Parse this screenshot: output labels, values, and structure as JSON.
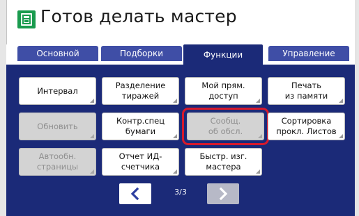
{
  "header": {
    "title": "Готов делать мастер",
    "icon": "master-making-icon",
    "icon_color": "#1a9b4e"
  },
  "tabs": [
    {
      "label": "Основной",
      "active": false
    },
    {
      "label": "Подборки",
      "active": false
    },
    {
      "label": "Функции",
      "active": true
    },
    {
      "label": "Управление",
      "active": false
    }
  ],
  "functions": {
    "interval": {
      "label": "Интервал",
      "enabled": true
    },
    "job_separation": {
      "label": "Разделение\nтиражей",
      "enabled": true
    },
    "my_direct_access": {
      "label": "Мой прям.\nдоступ",
      "enabled": true
    },
    "print_from_memory": {
      "label": "Печать\nиз памяти",
      "enabled": true
    },
    "refresh": {
      "label": "Обновить",
      "enabled": false
    },
    "special_paper_control": {
      "label": "Контр.спец\nбумаги",
      "enabled": true
    },
    "service_message": {
      "label": "Сообщ.\nоб обсл.",
      "enabled": false,
      "highlighted": true
    },
    "separator_sort": {
      "label": "Сортировка\nпрокл. Листов",
      "enabled": true
    },
    "auto_page_update": {
      "label": "Автообн.\nстраницы",
      "enabled": false
    },
    "id_counter_report": {
      "label": "Отчет ИД-\nсчетчика",
      "enabled": true
    },
    "quick_master": {
      "label": "Быстр. изг.\nмастера",
      "enabled": true
    }
  },
  "pagination": {
    "indicator": "3/3",
    "prev_icon": "chevron-left-icon",
    "next_icon": "chevron-right-icon",
    "next_enabled": false
  },
  "colors": {
    "panel": "#1b2a78",
    "tab": "#3f4ea6",
    "highlight": "#d7192b",
    "accent_blue": "#2d3fa0"
  }
}
